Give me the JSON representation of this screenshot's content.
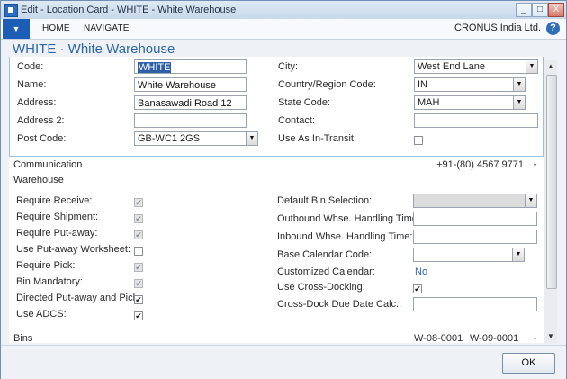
{
  "window": {
    "title": "Edit - Location Card - WHITE - White Warehouse",
    "minimize": "_",
    "maximize": "□",
    "close": "X"
  },
  "ribbon": {
    "menu_icon": "▼",
    "tabs": [
      "HOME",
      "NAVIGATE"
    ],
    "company": "CRONUS India Ltd.",
    "help": "?"
  },
  "page_title": "WHITE · White Warehouse",
  "general": {
    "code_label": "Code:",
    "code_value": "WHITE",
    "name_label": "Name:",
    "name_value": "White Warehouse",
    "address_label": "Address:",
    "address_value": "Banasawadi Road 12",
    "address2_label": "Address 2:",
    "address2_value": "",
    "post_code_label": "Post Code:",
    "post_code_value": "GB-WC1 2GS",
    "city_label": "City:",
    "city_value": "West End Lane",
    "country_label": "Country/Region Code:",
    "country_value": "IN",
    "state_label": "State Code:",
    "state_value": "MAH",
    "contact_label": "Contact:",
    "contact_value": "",
    "in_transit_label": "Use As In-Transit:",
    "in_transit_checked": false
  },
  "communication": {
    "title": "Communication",
    "summary": "+91-(80) 4567 9771",
    "chevron": "⌄"
  },
  "warehouse": {
    "title": "Warehouse",
    "left": [
      {
        "label": "Require Receive:",
        "checked": true,
        "disabled": true,
        "mark": "✔"
      },
      {
        "label": "Require Shipment:",
        "checked": true,
        "disabled": true,
        "mark": "✔"
      },
      {
        "label": "Require Put-away:",
        "checked": true,
        "disabled": true,
        "mark": "✔"
      },
      {
        "label": "Use Put-away Worksheet:",
        "checked": false,
        "disabled": false,
        "mark": ""
      },
      {
        "label": "Require Pick:",
        "checked": true,
        "disabled": true,
        "mark": "✔"
      },
      {
        "label": "Bin Mandatory:",
        "checked": true,
        "disabled": true,
        "mark": "✔"
      },
      {
        "label": "Directed Put-away and Pick:",
        "checked": true,
        "disabled": false,
        "mark": "✔"
      },
      {
        "label": "Use ADCS:",
        "checked": true,
        "disabled": false,
        "mark": "✔"
      }
    ],
    "default_bin_label": "Default Bin Selection:",
    "default_bin_value": "",
    "outbound_label": "Outbound Whse. Handling Time:",
    "outbound_value": "",
    "inbound_label": "Inbound Whse. Handling Time:",
    "inbound_value": "",
    "base_calendar_label": "Base Calendar Code:",
    "base_calendar_value": "",
    "customized_calendar_label": "Customized Calendar:",
    "customized_calendar_value": "No",
    "cross_docking_label": "Use Cross-Docking:",
    "cross_docking_mark": "✔",
    "cross_dock_calc_label": "Cross-Dock Due Date Calc.:",
    "cross_dock_calc_value": ""
  },
  "bins": {
    "title": "Bins",
    "value1": "W-08-0001",
    "value2": "W-09-0001",
    "chevron": "⌄"
  },
  "footer": {
    "ok_label": "OK"
  },
  "colors": {
    "accent": "#2d66a8",
    "highlight": "#f5f23c",
    "frame": "#9bc0e6"
  }
}
